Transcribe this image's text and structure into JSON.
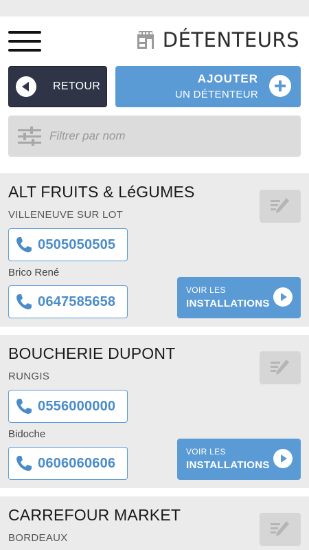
{
  "header": {
    "title": "DÉTENTEURS",
    "back_label": "RETOUR",
    "add_line1": "AJOUTER",
    "add_line2": "UN DÉTENTEUR"
  },
  "filter": {
    "placeholder": "Filtrer par nom",
    "value": ""
  },
  "holders": [
    {
      "name": "ALT FRUITS & LéGUMES",
      "city": "VILLENEUVE SUR LOT",
      "phone1": "0505050505",
      "contact": "Brico René",
      "phone2": "0647585658",
      "voir_line1": "VOIR LES",
      "voir_line2": "INSTALLATIONS"
    },
    {
      "name": "BOUCHERIE DUPONT",
      "city": "RUNGIS",
      "phone1": "0556000000",
      "contact": "Bidoche",
      "phone2": "0606060606",
      "voir_line1": "VOIR LES",
      "voir_line2": "INSTALLATIONS"
    },
    {
      "name": "CARREFOUR MARKET",
      "city": "BORDEAUX"
    }
  ],
  "colors": {
    "accent": "#5b9bd5",
    "dark_button": "#2f3447",
    "background": "#ebebeb"
  }
}
